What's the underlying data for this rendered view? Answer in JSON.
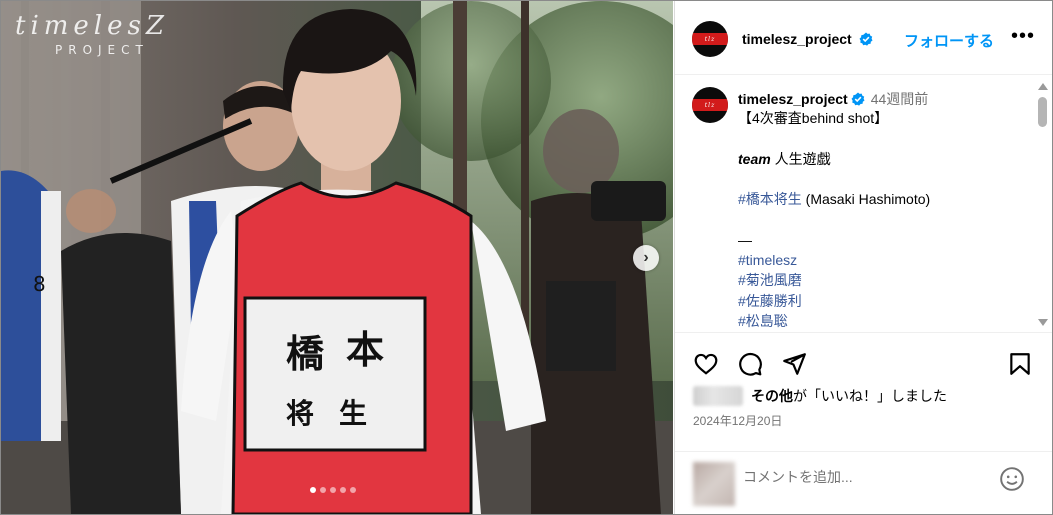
{
  "media": {
    "watermark_title": "timelesZ",
    "watermark_sub": "PROJECT",
    "slides_total": 5,
    "slide_active": 1,
    "next_icon": "chevron-right-icon",
    "bib_text": [
      "橋",
      "本",
      "将",
      "生"
    ]
  },
  "header": {
    "username": "timelesz_project",
    "follow_label": "フォローする",
    "more_icon": "more-horizontal-icon"
  },
  "caption": {
    "username": "timelesz_project",
    "time": "44週間前",
    "lines": [
      {
        "type": "text",
        "text": "【4次審査behind shot】"
      },
      {
        "type": "blank",
        "text": ""
      },
      {
        "type": "team",
        "text": "team",
        "rest": " 人生遊戯"
      },
      {
        "type": "blank",
        "text": ""
      },
      {
        "type": "tagtext",
        "text": "#橋本将生",
        "rest": " (Masaki Hashimoto)"
      },
      {
        "type": "blank",
        "text": ""
      },
      {
        "type": "text",
        "text": "—"
      },
      {
        "type": "tag",
        "text": "#timelesz"
      },
      {
        "type": "tag",
        "text": "#菊池風磨"
      },
      {
        "type": "tag",
        "text": "#佐藤勝利"
      },
      {
        "type": "tag",
        "text": "#松島聡"
      }
    ]
  },
  "actions": {
    "like_icon": "heart-icon",
    "comment_icon": "comment-icon",
    "share_icon": "send-icon",
    "save_icon": "bookmark-icon",
    "likes_bold": "その他",
    "likes_rest": "が「いいね！」しました",
    "date": "2024年12月20日"
  },
  "comment": {
    "placeholder": "コメントを追加...",
    "emoji_icon": "emoji-icon"
  },
  "colors": {
    "accent": "#0095f6",
    "hashtag": "#385898",
    "brand_red": "#d21b1b"
  }
}
